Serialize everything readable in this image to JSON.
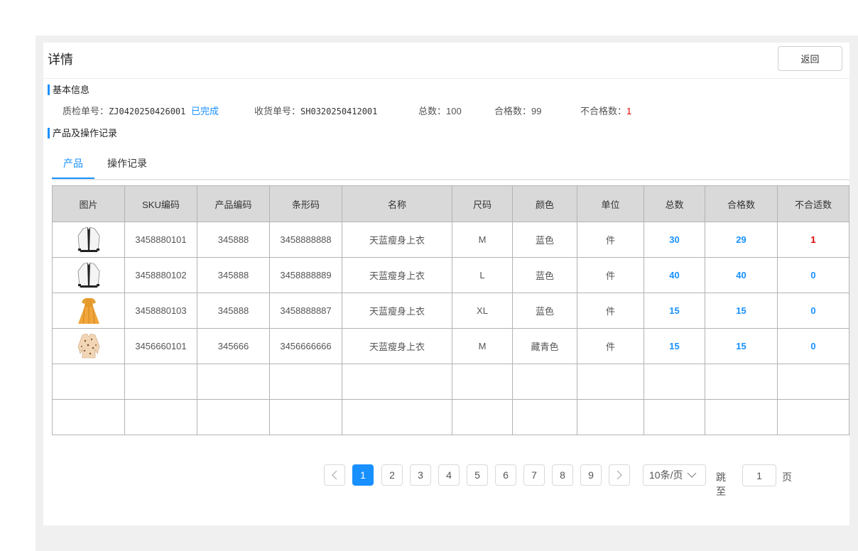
{
  "page": {
    "title": "详情",
    "back_label": "返回"
  },
  "basic": {
    "section_title": "基本信息",
    "qc_label": "质检单号：",
    "qc_no": "ZJ0420250426001",
    "status": "已完成",
    "receipt_label": "收货单号：",
    "receipt_no": "SH0320250412001",
    "total_label": "总数：",
    "total": "100",
    "pass_label": "合格数：",
    "pass": "99",
    "fail_label": "不合格数：",
    "fail": "1"
  },
  "records": {
    "section_title": "产品及操作记录",
    "tabs": [
      {
        "label": "产品"
      },
      {
        "label": "操作记录"
      }
    ]
  },
  "table": {
    "headers": [
      "图片",
      "SKU编码",
      "产品编码",
      "条形码",
      "名称",
      "尺码",
      "颜色",
      "单位",
      "总数",
      "合格数",
      "不合适数"
    ],
    "rows": [
      {
        "image": "white-cardigan",
        "sku": "3458880101",
        "product_code": "345888",
        "barcode": "3458888888",
        "name": "天蓝瘦身上衣",
        "size": "M",
        "color": "蓝色",
        "unit": "件",
        "total": "30",
        "pass": "29",
        "unfit": "1"
      },
      {
        "image": "white-cardigan",
        "sku": "3458880102",
        "product_code": "345888",
        "barcode": "3458888889",
        "name": "天蓝瘦身上衣",
        "size": "L",
        "color": "蓝色",
        "unit": "件",
        "total": "40",
        "pass": "40",
        "unfit": "0"
      },
      {
        "image": "orange-dress",
        "sku": "3458880103",
        "product_code": "345888",
        "barcode": "3458888887",
        "name": "天蓝瘦身上衣",
        "size": "XL",
        "color": "蓝色",
        "unit": "件",
        "total": "15",
        "pass": "15",
        "unfit": "0"
      },
      {
        "image": "leopard-blouse",
        "sku": "3456660101",
        "product_code": "345666",
        "barcode": "3456666666",
        "name": "天蓝瘦身上衣",
        "size": "M",
        "color": "藏青色",
        "unit": "件",
        "total": "15",
        "pass": "15",
        "unfit": "0"
      }
    ]
  },
  "pagination": {
    "pages": [
      "1",
      "2",
      "3",
      "4",
      "5",
      "6",
      "7",
      "8",
      "9"
    ],
    "current": "1",
    "page_size": "10条/页",
    "jump_label": "跳至",
    "jump_value": "1",
    "page_suffix": "页"
  },
  "colors": {
    "accent": "#1890ff",
    "danger": "#e00000",
    "header_bg": "#d9d9d9",
    "page_bg": "#f0f0f0"
  }
}
